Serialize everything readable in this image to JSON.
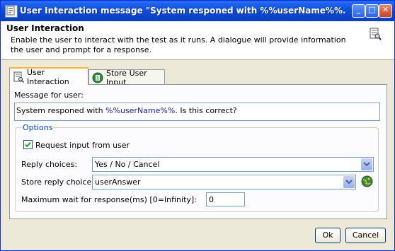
{
  "window": {
    "title": "User Interaction message \"System responed with %%userName%%. Is this correc...",
    "minimize_label": "_",
    "maximize_label": "□",
    "close_label": "✕"
  },
  "header": {
    "title": "User Interaction",
    "description": "Enable the user to interact with the test as it runs.  A dialogue will provide information the user and prompt for a response."
  },
  "tabs": [
    {
      "label": "User Interaction",
      "active": true,
      "icon": "user-interaction-icon"
    },
    {
      "label": "Store User Input",
      "active": false,
      "icon": "store-input-icon"
    }
  ],
  "form": {
    "message_label": "Message for user:",
    "message_prefix": "System responed with ",
    "message_var": "%%userName%%",
    "message_suffix": ". Is this correct?",
    "options_legend": "Options",
    "request_input_label": "Request input from user",
    "request_input_checked": true,
    "reply_choices_label": "Reply choices:",
    "reply_choices_value": "Yes / No / Cancel",
    "store_reply_label": "Store reply choice:",
    "store_reply_value": "userAnswer",
    "max_wait_label": "Maximum wait for response(ms) [0=Infinity]:",
    "max_wait_value": "0"
  },
  "buttons": {
    "ok": "Ok",
    "cancel": "Cancel"
  },
  "colors": {
    "titlebar": "#0a4fdd",
    "accent_tab": "#f5b83c",
    "legend": "#0046d5"
  }
}
